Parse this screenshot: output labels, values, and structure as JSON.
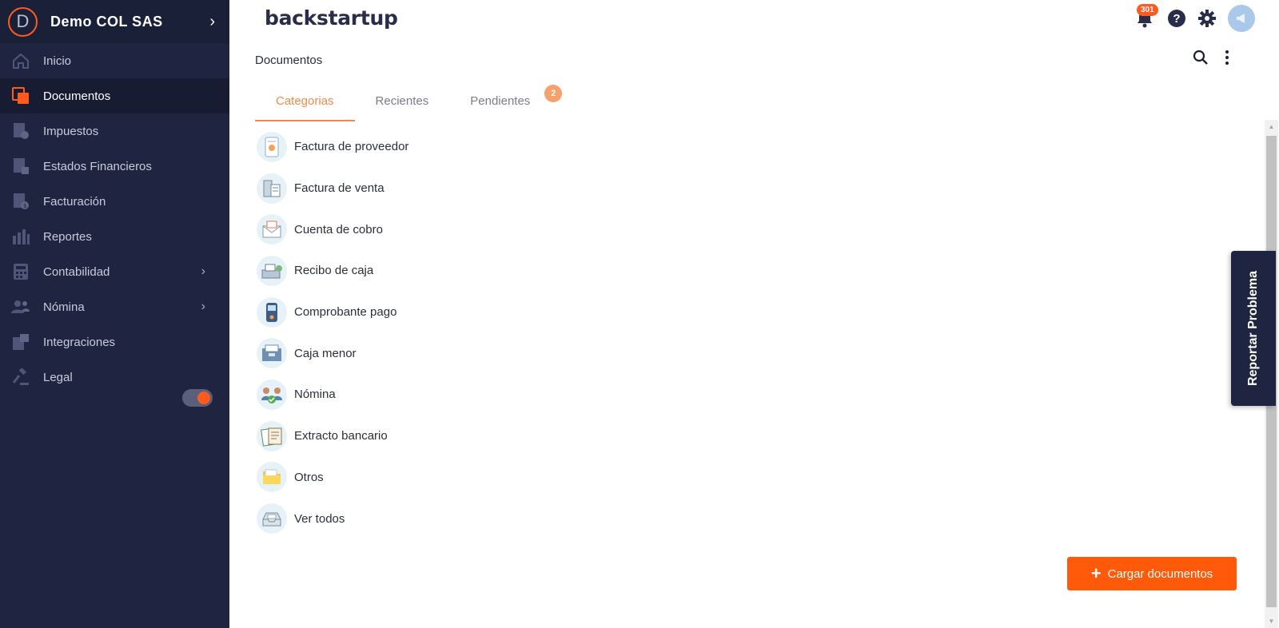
{
  "sidebar": {
    "company_initial": "D",
    "company_name": "Demo COL SAS",
    "items": [
      {
        "label": "Inicio",
        "icon": "home-icon"
      },
      {
        "label": "Documentos",
        "icon": "documents-icon",
        "active": true
      },
      {
        "label": "Impuestos",
        "icon": "taxes-icon"
      },
      {
        "label": "Estados Financieros",
        "icon": "financial-statements-icon"
      },
      {
        "label": "Facturación",
        "icon": "invoicing-icon"
      },
      {
        "label": "Reportes",
        "icon": "reports-icon"
      },
      {
        "label": "Contabilidad",
        "icon": "accounting-icon",
        "has_submenu": true
      },
      {
        "label": "Nómina",
        "icon": "payroll-icon",
        "has_submenu": true
      },
      {
        "label": "Integraciones",
        "icon": "integrations-icon"
      },
      {
        "label": "Legal",
        "icon": "legal-icon"
      }
    ],
    "toggle_on": true
  },
  "topbar": {
    "logo": "backstartup",
    "notification_count": "301",
    "icons": [
      "bell-icon",
      "help-icon",
      "gear-icon",
      "avatar"
    ]
  },
  "page": {
    "title": "Documentos",
    "tabs": [
      {
        "label": "Categorias",
        "active": true
      },
      {
        "label": "Recientes"
      },
      {
        "label": "Pendientes",
        "badge": "2"
      }
    ]
  },
  "categories": [
    {
      "label": "Factura de proveedor",
      "icon": "supplier-invoice-icon"
    },
    {
      "label": "Factura de venta",
      "icon": "sales-invoice-icon"
    },
    {
      "label": "Cuenta de cobro",
      "icon": "collection-account-icon"
    },
    {
      "label": "Recibo de caja",
      "icon": "cash-receipt-icon"
    },
    {
      "label": "Comprobante pago",
      "icon": "payment-voucher-icon"
    },
    {
      "label": "Caja menor",
      "icon": "petty-cash-icon"
    },
    {
      "label": "Nómina",
      "icon": "payroll-category-icon"
    },
    {
      "label": "Extracto bancario",
      "icon": "bank-statement-icon"
    },
    {
      "label": "Otros",
      "icon": "folder-icon"
    },
    {
      "label": "Ver todos",
      "icon": "inbox-tray-icon"
    }
  ],
  "report_problem": "Reportar Problema",
  "upload_button": "Cargar documentos",
  "colors": {
    "sidebar_bg": "#1f2541",
    "accent_orange": "#ff5a0a",
    "tab_active": "#f28a4b"
  }
}
